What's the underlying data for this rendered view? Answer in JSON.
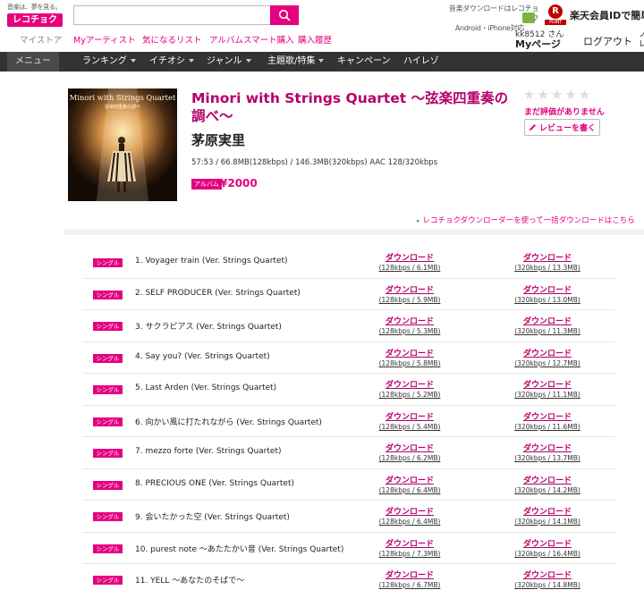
{
  "header": {
    "logo_tagline": "音楽は、夢を見る。",
    "logo_text": "レコチョク",
    "search_placeholder": "",
    "dl_info_line1": "音楽ダウンロードはレコチョク",
    "dl_info_line2": "Android・iPhone対応",
    "rakuten_mark": "R",
    "rakuten_point": "POINT",
    "rakuten_text": "楽天会員IDで簡単決"
  },
  "subnav": {
    "items": [
      "マイストア",
      "Myアーティスト",
      "気になるリスト",
      "アルバムスマート購入",
      "購入履歴"
    ],
    "user_name": "kk8512 さん",
    "mypage": "Myページ",
    "logout": "ログアウト",
    "misc1": "ノ",
    "misc2": "レ"
  },
  "mainnav": {
    "menu": "メニュー",
    "items": [
      "ランキング",
      "イチオシ",
      "ジャンル",
      "主題歌/特集",
      "キャンペーン",
      "ハイレゾ"
    ]
  },
  "album": {
    "cover_title": "Minori with Strings Quartet",
    "cover_subtitle": "弦楽四重奏の調べ",
    "title": "Minori with Strings Quartet ～弦楽四重奏の調べ～",
    "artist": "茅原実里",
    "meta": "57:53 / 66.8MB(128kbps) / 146.3MB(320kbps) AAC 128/320kbps",
    "badge": "アルバム",
    "price": "¥2000",
    "rating": 0,
    "no_rating": "まだ評価がありません",
    "review_button": "レビューを書く",
    "bulk_link": "レコチョクダウンローダーを使って一括ダウンロードはこちら"
  },
  "tracks": [
    {
      "badge": "シングル",
      "title": "1.  Voyager train (Ver. Strings Quartet)",
      "dl_label": "ダウンロード",
      "low": "(128kbps / 6.1MB)",
      "high": "(320kbps / 13.3MB)"
    },
    {
      "badge": "シングル",
      "title": "2.  SELF PRODUCER (Ver. Strings Quartet)",
      "dl_label": "ダウンロード",
      "low": "(128kbps / 5.9MB)",
      "high": "(320kbps / 13.0MB)"
    },
    {
      "badge": "シングル",
      "title": "3.  サクラビアス (Ver. Strings Quartet)",
      "dl_label": "ダウンロード",
      "low": "(128kbps / 5.3MB)",
      "high": "(320kbps / 11.3MB)"
    },
    {
      "badge": "シングル",
      "title": "4.  Say you? (Ver. Strings Quartet)",
      "dl_label": "ダウンロード",
      "low": "(128kbps / 5.8MB)",
      "high": "(320kbps / 12.7MB)"
    },
    {
      "badge": "シングル",
      "title": "5.  Last Arden (Ver. Strings Quartet)",
      "dl_label": "ダウンロード",
      "low": "(128kbps / 5.2MB)",
      "high": "(320kbps / 11.1MB)"
    },
    {
      "badge": "シングル",
      "title": "6.  向かい風に打たれながら (Ver. Strings Quartet)",
      "dl_label": "ダウンロード",
      "low": "(128kbps / 5.4MB)",
      "high": "(320kbps / 11.6MB)"
    },
    {
      "badge": "シングル",
      "title": "7.  mezzo forte (Ver. Strings Quartet)",
      "dl_label": "ダウンロード",
      "low": "(128kbps / 6.2MB)",
      "high": "(320kbps / 13.7MB)"
    },
    {
      "badge": "シングル",
      "title": "8.  PRECIOUS ONE (Ver. Strings Quartet)",
      "dl_label": "ダウンロード",
      "low": "(128kbps / 6.4MB)",
      "high": "(320kbps / 14.2MB)"
    },
    {
      "badge": "シングル",
      "title": "9.  会いたかった空 (Ver. Strings Quartet)",
      "dl_label": "ダウンロード",
      "low": "(128kbps / 6.4MB)",
      "high": "(320kbps / 14.1MB)"
    },
    {
      "badge": "シングル",
      "title": "10.  purest note ～あたたかい音 (Ver. Strings Quartet)",
      "dl_label": "ダウンロード",
      "low": "(128kbps / 7.3MB)",
      "high": "(320kbps / 16.4MB)"
    },
    {
      "badge": "シングル",
      "title": "11.  YELL ～あなたのそばで～",
      "dl_label": "ダウンロード",
      "low": "(128kbps / 6.7MB)",
      "high": "(320kbps / 14.8MB)"
    }
  ],
  "colors": {
    "brand": "#e4007f",
    "title": "#b5006b",
    "nav_bg": "#333333"
  }
}
